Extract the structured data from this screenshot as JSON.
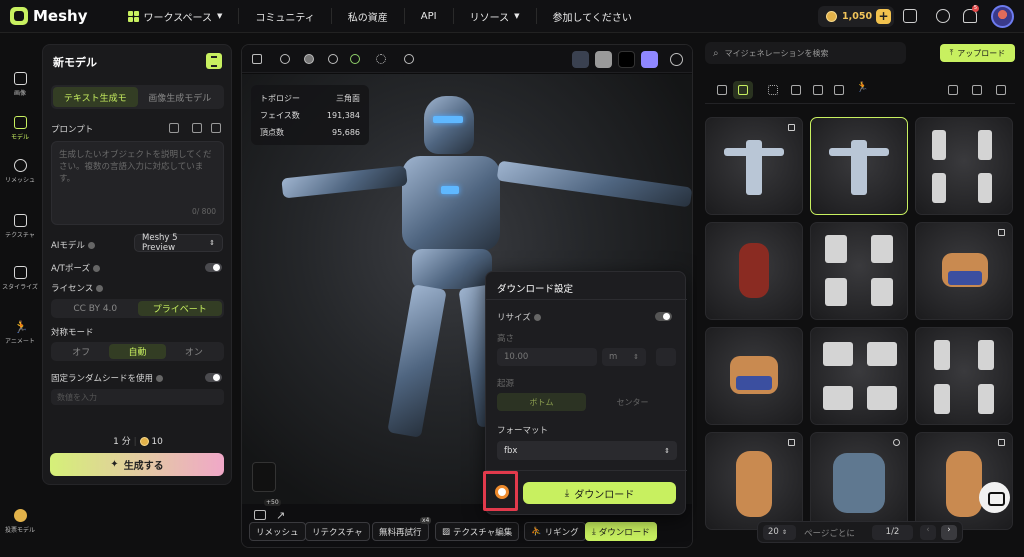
{
  "app": {
    "logo": "Meshy"
  },
  "nav": {
    "workspace": "ワークスペース",
    "items": [
      "コミュニティ",
      "私の資産",
      "API",
      "リソース",
      "参加してください"
    ]
  },
  "credits": {
    "amount": "1,050",
    "plus": "+"
  },
  "notifications": {
    "count": "5"
  },
  "rail": [
    {
      "label": "画像"
    },
    {
      "label": "モデル"
    },
    {
      "label": "リメッシュ"
    },
    {
      "label": "テクスチャ"
    },
    {
      "label": "スタイライズ"
    },
    {
      "label": "アニメート"
    },
    {
      "label": "投票モデル"
    }
  ],
  "left_panel": {
    "title": "新モデル",
    "tabs": [
      "テキスト生成モ",
      "画像生成モデル"
    ],
    "prompt_label": "プロンプト",
    "prompt_placeholder": "生成したいオブジェクトを説明してください。複数の言語入力に対応しています。",
    "prompt_counter": "0/ 800",
    "ai_model_label": "AIモデル",
    "ai_model_value": "Meshy 5 Preview",
    "at_pose_label": "A/Tポーズ",
    "license_label": "ライセンス",
    "license_options": [
      "CC BY 4.0",
      "プライベート"
    ],
    "symmetry_label": "対称モード",
    "symmetry_options": [
      "オフ",
      "自動",
      "オン"
    ],
    "seed_label": "固定ランダムシードを使用",
    "seed_placeholder": "数値を入力",
    "cost_time": "1 分",
    "cost_credits": "10",
    "generate_label": "生成する"
  },
  "viewport": {
    "stats": [
      {
        "k": "トポロジー",
        "v": "三角面"
      },
      {
        "k": "フェイス数",
        "v": "191,384"
      },
      {
        "k": "頂点数",
        "v": "95,686"
      }
    ],
    "bottom_badge": "+50",
    "retry_badge": "x4",
    "actions": [
      "リメッシュ",
      "リテクスチャ",
      "無料再試行",
      "テクスチャ編集",
      "リギング",
      "ダウンロード"
    ],
    "swatch_colors": [
      "#3a4150",
      "#9a9a9a",
      "#000000",
      "#8f87ff"
    ]
  },
  "download": {
    "title": "ダウンロード設定",
    "resize_label": "リサイズ",
    "height_label": "高さ",
    "height_value": "10.00",
    "unit": "m",
    "origin_label": "起源",
    "origin_options": [
      "ボトム",
      "センター"
    ],
    "format_label": "フォーマット",
    "format_value": "fbx",
    "download_label": "ダウンロード"
  },
  "right_panel": {
    "search_placeholder": "マイジェネレーションを検索",
    "upload_label": "アップロード",
    "pager": {
      "per_page": "20",
      "per_page_label": "ページごとに",
      "page": "1/2"
    }
  },
  "accent": "#c8f060"
}
